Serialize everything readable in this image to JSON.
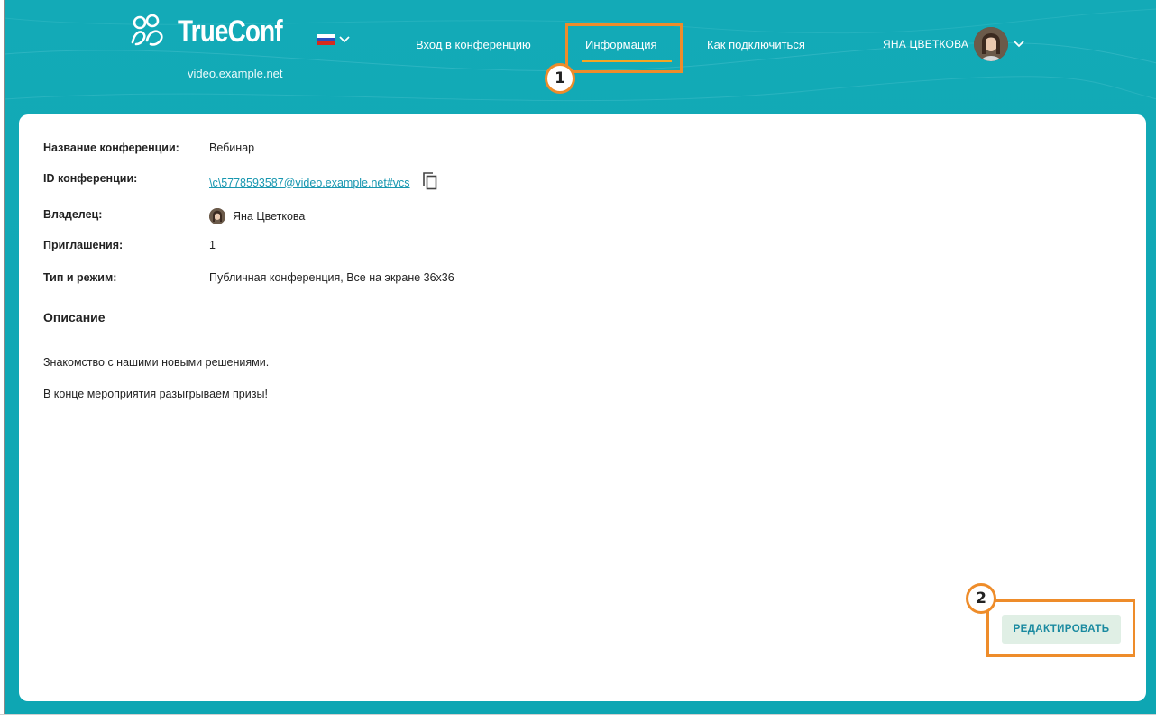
{
  "header": {
    "logo_text": "TrueConf",
    "domain": "video.example.net",
    "language_flag": "ru-flag-icon",
    "nav": [
      {
        "label": "Вход в конференцию"
      },
      {
        "label": "Информация",
        "active": true
      },
      {
        "label": "Как подключиться"
      }
    ],
    "user_name": "ЯНА ЦВЕТКОВА"
  },
  "conference": {
    "name_label": "Название конференции:",
    "name_value": "Вебинар",
    "id_label": "ID конференции:",
    "id_value": "\\c\\5778593587@video.example.net#vcs",
    "owner_label": "Владелец:",
    "owner_value": "Яна Цветкова",
    "invites_label": "Приглашения:",
    "invites_value": "1",
    "type_label": "Тип и режим:",
    "type_value": "Публичная конференция, Все на экране 36x36"
  },
  "description": {
    "title": "Описание",
    "lines": [
      "Знакомство с нашими новыми решениями.",
      "В конце мероприятия разыгрываем призы!"
    ]
  },
  "actions": {
    "edit_label": "РЕДАКТИРОВАТЬ"
  },
  "annotations": [
    {
      "number": "1"
    },
    {
      "number": "2"
    }
  ],
  "colors": {
    "header_bg": "#0fa8b5",
    "annotation": "#ee8c2a",
    "link": "#1897b0",
    "edit_button_bg": "#e0efe5"
  }
}
